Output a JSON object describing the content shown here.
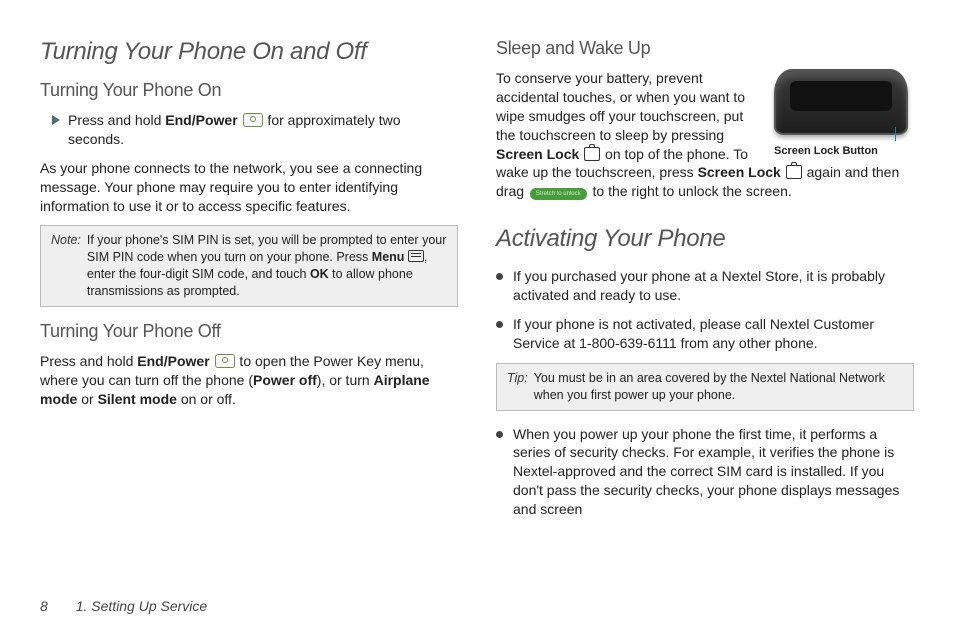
{
  "left": {
    "h1": "Turning Your Phone On and Off",
    "on": {
      "h2": "Turning Your Phone On",
      "bullet_pre": "Press and hold ",
      "end_power": "End/Power",
      "bullet_post": " for approximately two seconds.",
      "para": "As your phone connects to the network, you see a connecting message. Your phone may require you to enter identifying information to use it or to access specific features."
    },
    "note": {
      "label": "Note:",
      "l1a": "If your phone's SIM PIN is set, you will be prompted to enter your SIM PIN code when you turn on your phone. Press ",
      "menu": "Menu",
      "l1b": ", enter the four-digit SIM code, and touch ",
      "ok": "OK",
      "l1c": " to allow phone transmissions as prompted."
    },
    "off": {
      "h2": "Turning Your Phone Off",
      "p_pre": "Press and hold ",
      "end_power": "End/Power",
      "p_mid": " to open the Power Key menu, where you can turn off the phone (",
      "poweroff": "Power off",
      "p_mid2": "), or turn ",
      "airplane": "Airplane mode",
      "or": " or ",
      "silent": "Silent mode",
      "p_end": " on or off."
    }
  },
  "right": {
    "sleep": {
      "h2": "Sleep and Wake Up",
      "p1a": "To conserve your battery, prevent accidental touches, or when you want to wipe smudges off your touchscreen, put the touchscreen to sleep by pressing ",
      "sl1": "Screen Lock",
      "p1b": " on top of the phone. To wake up the touchscreen, press ",
      "sl2": "Screen Lock",
      "p1c": " again and then drag ",
      "pill": "Stretch to unlock",
      "p1d": " to the right to unlock the screen.",
      "caption": "Screen Lock Button"
    },
    "act": {
      "h1": "Activating Your Phone",
      "b1": "If you purchased your phone at a Nextel Store, it is probably activated and ready to use.",
      "b2": "If your phone is not activated, please call Nextel Customer Service at 1-800-639-6111 from any other phone.",
      "tip_label": "Tip:",
      "tip": "You must be in an area covered by the Nextel National Network when you first power up your phone.",
      "b3": "When you power up your phone the first time, it performs a series of security checks. For example, it verifies the phone is Nextel-approved and the correct SIM card is installed. If you don't pass the security checks, your phone displays messages and screen"
    }
  },
  "footer": {
    "page": "8",
    "section": "1. Setting Up Service"
  }
}
